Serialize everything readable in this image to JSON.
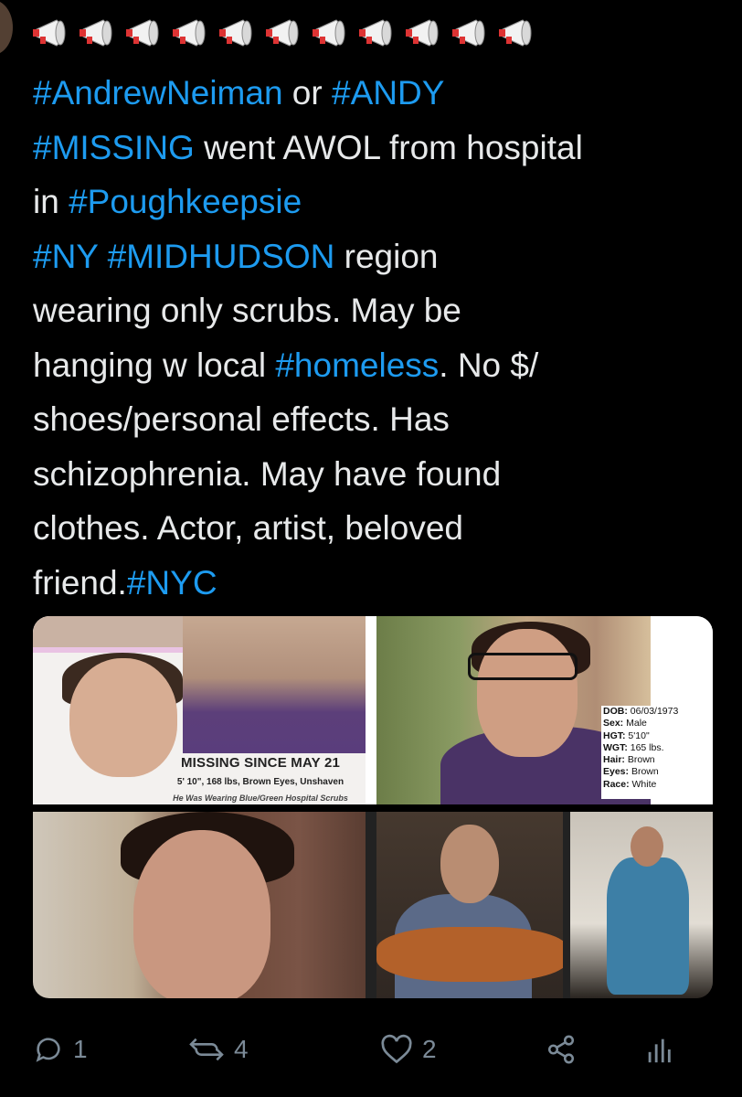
{
  "tweet": {
    "emoji": "📢",
    "emoji_count": 11,
    "lines": [
      [
        {
          "t": "#AndrewNeiman",
          "tag": true
        },
        {
          "t": " or ",
          "tag": false
        },
        {
          "t": "#ANDY",
          "tag": true
        }
      ],
      [
        {
          "t": "#MISSING",
          "tag": true
        },
        {
          "t": " went AWOL from hospital",
          "tag": false
        }
      ],
      [
        {
          "t": "in ",
          "tag": false
        },
        {
          "t": "#Poughkeepsie",
          "tag": true
        }
      ],
      [
        {
          "t": "#NY",
          "tag": true
        },
        {
          "t": " ",
          "tag": false
        },
        {
          "t": "#MIDHUDSON",
          "tag": true
        },
        {
          "t": " region",
          "tag": false
        }
      ],
      [
        {
          "t": "wearing only scrubs. May be",
          "tag": false
        }
      ],
      [
        {
          "t": "hanging w local ",
          "tag": false
        },
        {
          "t": "#homeless",
          "tag": true
        },
        {
          "t": ". No $/",
          "tag": false
        }
      ],
      [
        {
          "t": "shoes/personal effects. Has",
          "tag": false
        }
      ],
      [
        {
          "t": "schizophrenia. May have found",
          "tag": false
        }
      ],
      [
        {
          "t": "clothes. Actor, artist, beloved",
          "tag": false
        }
      ],
      [
        {
          "t": "friend.",
          "tag": false
        },
        {
          "t": "#NYC",
          "tag": true
        }
      ]
    ]
  },
  "media": {
    "poster": {
      "headline": "MISSING SINCE MAY 21",
      "details": "5' 10\", 168 lbs, Brown Eyes, Unshaven",
      "details2": "He Was Wearing Blue/Green Hospital Scrubs"
    },
    "info": [
      {
        "k": "DOB:",
        "v": "06/03/1973"
      },
      {
        "k": "Sex:",
        "v": "Male"
      },
      {
        "k": "HGT:",
        "v": "5'10\""
      },
      {
        "k": "WGT:",
        "v": "165 lbs."
      },
      {
        "k": "Hair:",
        "v": "Brown"
      },
      {
        "k": "Eyes:",
        "v": "Brown"
      },
      {
        "k": "Race:",
        "v": "White"
      }
    ]
  },
  "actions": {
    "reply_count": "1",
    "retweet_count": "4",
    "like_count": "2"
  },
  "colors": {
    "hashtag": "#1d9bf0",
    "text": "#e7e9ea",
    "icon": "#7b8a97"
  }
}
